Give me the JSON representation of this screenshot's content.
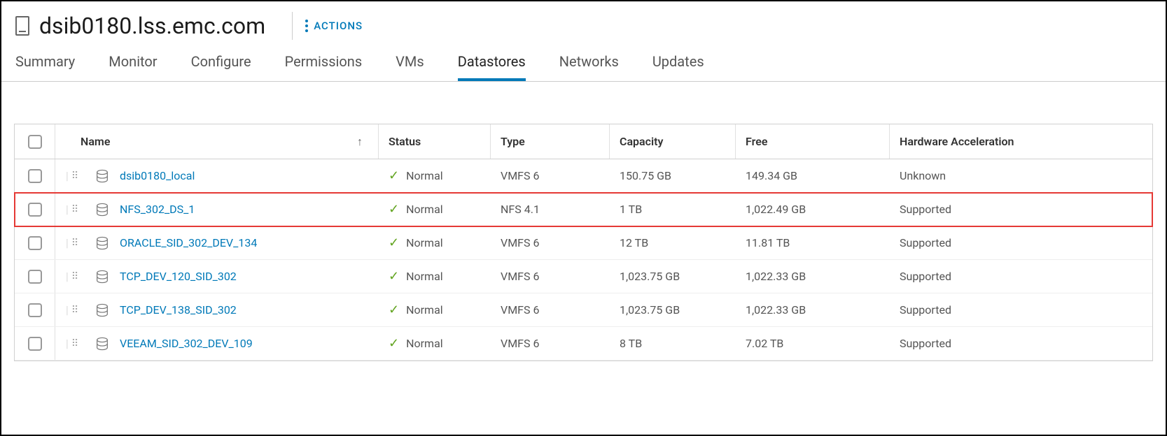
{
  "header": {
    "title": "dsib0180.lss.emc.com",
    "actions_label": "ACTIONS"
  },
  "tabs": [
    {
      "label": "Summary",
      "active": false
    },
    {
      "label": "Monitor",
      "active": false
    },
    {
      "label": "Configure",
      "active": false
    },
    {
      "label": "Permissions",
      "active": false
    },
    {
      "label": "VMs",
      "active": false
    },
    {
      "label": "Datastores",
      "active": true
    },
    {
      "label": "Networks",
      "active": false
    },
    {
      "label": "Updates",
      "active": false
    }
  ],
  "table": {
    "columns": {
      "name": "Name",
      "status": "Status",
      "type": "Type",
      "capacity": "Capacity",
      "free": "Free",
      "hw_accel": "Hardware Acceleration"
    },
    "sort_indicator": "↑",
    "rows": [
      {
        "name": "dsib0180_local",
        "status": "Normal",
        "type": "VMFS 6",
        "capacity": "150.75 GB",
        "free": "149.34 GB",
        "hw": "Unknown",
        "highlighted": false
      },
      {
        "name": "NFS_302_DS_1",
        "status": "Normal",
        "type": "NFS 4.1",
        "capacity": "1 TB",
        "free": "1,022.49 GB",
        "hw": "Supported",
        "highlighted": true
      },
      {
        "name": "ORACLE_SID_302_DEV_134",
        "status": "Normal",
        "type": "VMFS 6",
        "capacity": "12 TB",
        "free": "11.81 TB",
        "hw": "Supported",
        "highlighted": false
      },
      {
        "name": "TCP_DEV_120_SID_302",
        "status": "Normal",
        "type": "VMFS 6",
        "capacity": "1,023.75 GB",
        "free": "1,022.33 GB",
        "hw": "Supported",
        "highlighted": false
      },
      {
        "name": "TCP_DEV_138_SID_302",
        "status": "Normal",
        "type": "VMFS 6",
        "capacity": "1,023.75 GB",
        "free": "1,022.33 GB",
        "hw": "Supported",
        "highlighted": false
      },
      {
        "name": "VEEAM_SID_302_DEV_109",
        "status": "Normal",
        "type": "VMFS 6",
        "capacity": "8 TB",
        "free": "7.02 TB",
        "hw": "Supported",
        "highlighted": false
      }
    ]
  }
}
